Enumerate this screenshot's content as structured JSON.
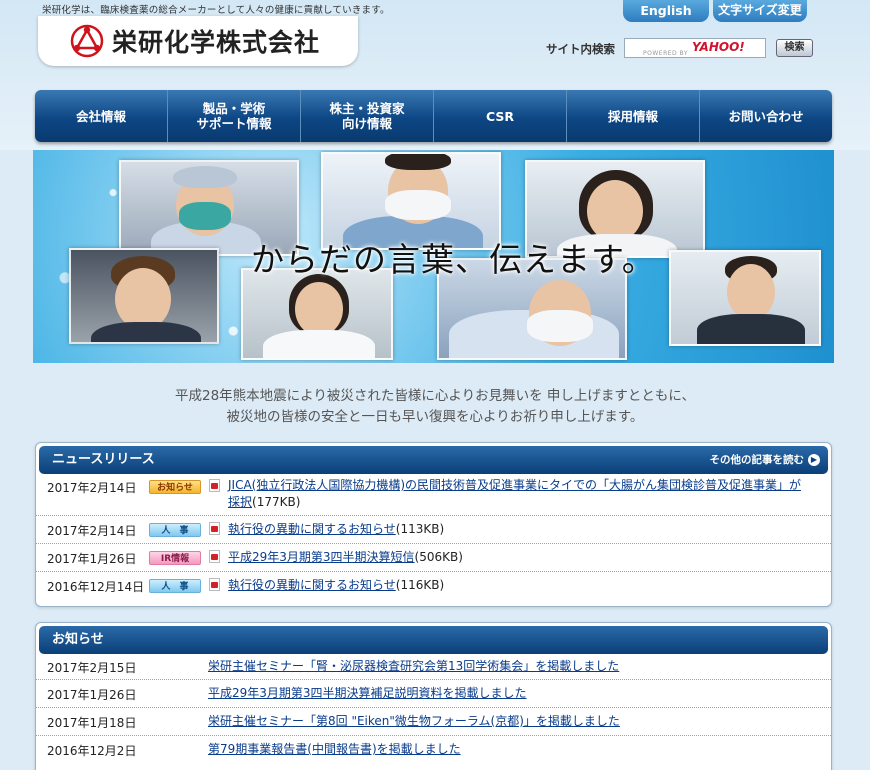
{
  "header": {
    "tagline": "栄研化学は、臨床検査薬の総合メーカーとして人々の健康に貢献していきます。",
    "company_name": "栄研化学株式会社",
    "english_link": "English",
    "font_size_link": "文字サイズ変更",
    "search_label": "サイト内検索",
    "search_powered_by": "POWERED BY",
    "search_engine": "YAHOO!",
    "search_button": "検索"
  },
  "global_nav": [
    {
      "label": "会社情報"
    },
    {
      "label": "製品・学術\nサポート情報"
    },
    {
      "label": "株主・投資家\n向け情報"
    },
    {
      "label": "CSR"
    },
    {
      "label": "採用情報"
    },
    {
      "label": "お問い合わせ"
    }
  ],
  "hero": {
    "copy": "からだの言葉、伝えます。"
  },
  "condolence": {
    "line1": "平成28年熊本地震により被災された皆様に心よりお見舞いを 申し上げますとともに、",
    "line2": "被災地の皆様の安全と一日も早い復興を心よりお祈り申し上げます。"
  },
  "news_release": {
    "title": "ニュースリリース",
    "more_link": "その他の記事を読む",
    "items": [
      {
        "date": "2017年2月14日",
        "category": "お知らせ",
        "category_color": "#f6b42a",
        "title": "JICA(独立行政法人国際協力機構)の民間技術普及促進事業にタイでの「大腸がん集団検診普及促進事業」が採択",
        "size": "(177KB)"
      },
      {
        "date": "2017年2月14日",
        "category": "人　事",
        "category_color": "#7fc8ee",
        "title": "執行役の異動に関するお知らせ",
        "size": "(113KB)"
      },
      {
        "date": "2017年1月26日",
        "category": "IR情報",
        "category_color": "#f49abf",
        "title": "平成29年3月期第3四半期決算短信",
        "size": "(506KB)"
      },
      {
        "date": "2016年12月14日",
        "category": "人　事",
        "category_color": "#7fc8ee",
        "title": "執行役の異動に関するお知らせ",
        "size": "(116KB)"
      }
    ]
  },
  "notices": {
    "title": "お知らせ",
    "items": [
      {
        "date": "2017年2月15日",
        "title": "栄研主催セミナー「腎・泌尿器検査研究会第13回学術集会」を掲載しました"
      },
      {
        "date": "2017年1月26日",
        "title": "平成29年3月期第3四半期決算補足説明資料を掲載しました"
      },
      {
        "date": "2017年1月18日",
        "title": "栄研主催セミナー「第8回 \"Eiken\"微生物フォーラム(京都)」を掲載しました"
      },
      {
        "date": "2016年12月2日",
        "title": "第79期事業報告書(中間報告書)を掲載しました"
      }
    ]
  }
}
